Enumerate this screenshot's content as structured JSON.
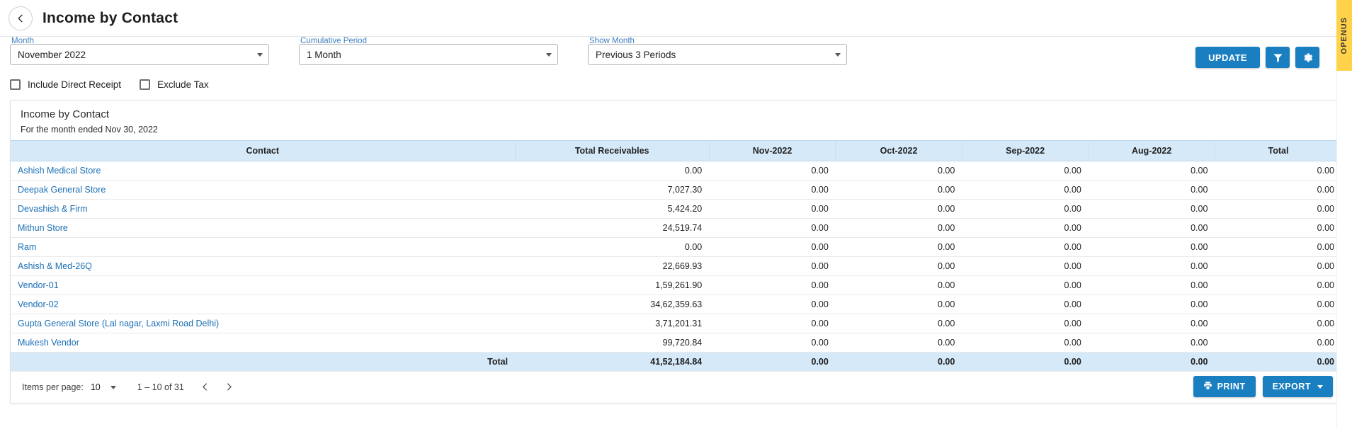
{
  "header": {
    "title": "Income by Contact",
    "back_icon": "chevron-left-icon"
  },
  "filters": {
    "month": {
      "label": "Month",
      "value": "November 2022"
    },
    "cumulative_period": {
      "label": "Cumulative Period",
      "value": "1 Month"
    },
    "show_month": {
      "label": "Show Month",
      "value": "Previous 3 Periods"
    },
    "update_label": "UPDATE",
    "filter_icon": "filter-icon",
    "settings_icon": "gear-icon"
  },
  "options": {
    "include_direct_receipt": "Include Direct Receipt",
    "exclude_tax": "Exclude Tax"
  },
  "report": {
    "title": "Income by Contact",
    "subtitle": "For the month ended Nov 30, 2022",
    "columns": [
      "Contact",
      "Total Receivables",
      "Nov-2022",
      "Oct-2022",
      "Sep-2022",
      "Aug-2022",
      "Total"
    ],
    "rows": [
      {
        "contact": "Ashish Medical Store",
        "receivables": "0.00",
        "nov": "0.00",
        "oct": "0.00",
        "sep": "0.00",
        "aug": "0.00",
        "total": "0.00"
      },
      {
        "contact": "Deepak General Store",
        "receivables": "7,027.30",
        "nov": "0.00",
        "oct": "0.00",
        "sep": "0.00",
        "aug": "0.00",
        "total": "0.00"
      },
      {
        "contact": "Devashish & Firm",
        "receivables": "5,424.20",
        "nov": "0.00",
        "oct": "0.00",
        "sep": "0.00",
        "aug": "0.00",
        "total": "0.00"
      },
      {
        "contact": "Mithun Store",
        "receivables": "24,519.74",
        "nov": "0.00",
        "oct": "0.00",
        "sep": "0.00",
        "aug": "0.00",
        "total": "0.00"
      },
      {
        "contact": "Ram",
        "receivables": "0.00",
        "nov": "0.00",
        "oct": "0.00",
        "sep": "0.00",
        "aug": "0.00",
        "total": "0.00"
      },
      {
        "contact": "Ashish & Med-26Q",
        "receivables": "22,669.93",
        "nov": "0.00",
        "oct": "0.00",
        "sep": "0.00",
        "aug": "0.00",
        "total": "0.00"
      },
      {
        "contact": "Vendor-01",
        "receivables": "1,59,261.90",
        "nov": "0.00",
        "oct": "0.00",
        "sep": "0.00",
        "aug": "0.00",
        "total": "0.00"
      },
      {
        "contact": "Vendor-02",
        "receivables": "34,62,359.63",
        "nov": "0.00",
        "oct": "0.00",
        "sep": "0.00",
        "aug": "0.00",
        "total": "0.00"
      },
      {
        "contact": "Gupta General Store (Lal nagar, Laxmi Road Delhi)",
        "receivables": "3,71,201.31",
        "nov": "0.00",
        "oct": "0.00",
        "sep": "0.00",
        "aug": "0.00",
        "total": "0.00"
      },
      {
        "contact": "Mukesh Vendor",
        "receivables": "99,720.84",
        "nov": "0.00",
        "oct": "0.00",
        "sep": "0.00",
        "aug": "0.00",
        "total": "0.00"
      }
    ],
    "total_row": {
      "label": "Total",
      "receivables": "41,52,184.84",
      "nov": "0.00",
      "oct": "0.00",
      "sep": "0.00",
      "aug": "0.00",
      "total": "0.00"
    }
  },
  "paginator": {
    "items_per_page_label": "Items per page:",
    "items_per_page_value": "10",
    "range": "1 – 10 of 31",
    "prev_icon": "chevron-left-icon",
    "next_icon": "chevron-right-icon"
  },
  "footer": {
    "print_label": "PRINT",
    "print_icon": "printer-icon",
    "export_label": "EXPORT"
  },
  "side_tab": {
    "label": "OPENUS"
  }
}
